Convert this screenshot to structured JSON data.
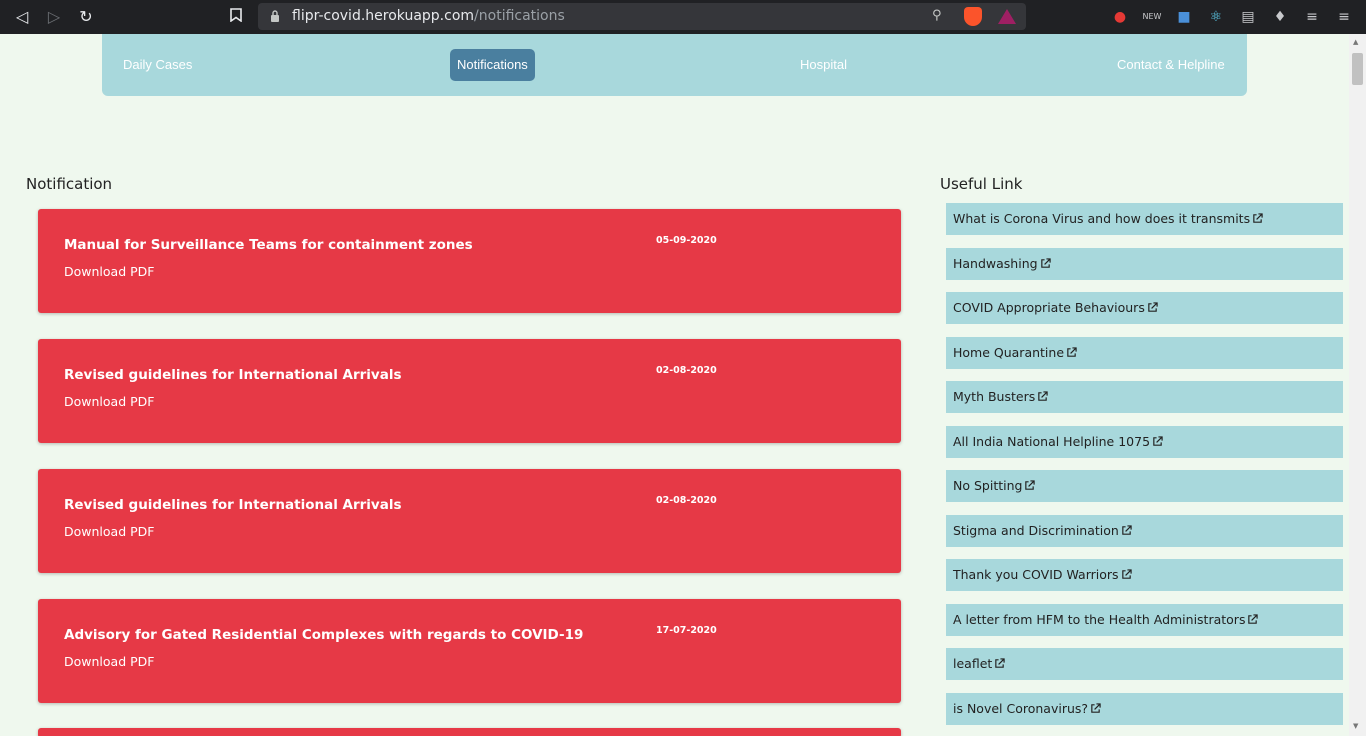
{
  "browser": {
    "url_host": "flipr-covid.herokuapp.com",
    "url_path": "/notifications"
  },
  "navbar": {
    "items": [
      {
        "label": "Daily Cases"
      },
      {
        "label": "Notifications"
      },
      {
        "label": "Hospital"
      },
      {
        "label": "Contact & Helpline"
      }
    ],
    "active": "Notifications"
  },
  "notifications": {
    "heading": "Notification",
    "download_label": "Download PDF",
    "items": [
      {
        "title": "Manual for Surveillance Teams for containment zones",
        "date": "05-09-2020"
      },
      {
        "title": "Revised guidelines for International Arrivals",
        "date": "02-08-2020"
      },
      {
        "title": "Revised guidelines for International Arrivals",
        "date": "02-08-2020"
      },
      {
        "title": "Advisory for Gated Residential Complexes with regards to COVID-19",
        "date": "17-07-2020"
      }
    ]
  },
  "useful_links": {
    "heading": "Useful Link",
    "items": [
      "What is Corona Virus and how does it transmits",
      "Handwashing",
      "COVID Appropriate Behaviours",
      "Home Quarantine",
      "Myth Busters",
      "All India National Helpline 1075",
      "No Spitting",
      "Stigma and Discrimination",
      "Thank you COVID Warriors",
      "A letter from HFM to the Health Administrators",
      "leaflet",
      "is Novel Coronavirus?"
    ]
  },
  "colors": {
    "card": "#e63946",
    "navbar": "#a8d8dc",
    "active_tab": "#4a7f9f",
    "page_bg": "#eff8ee"
  }
}
